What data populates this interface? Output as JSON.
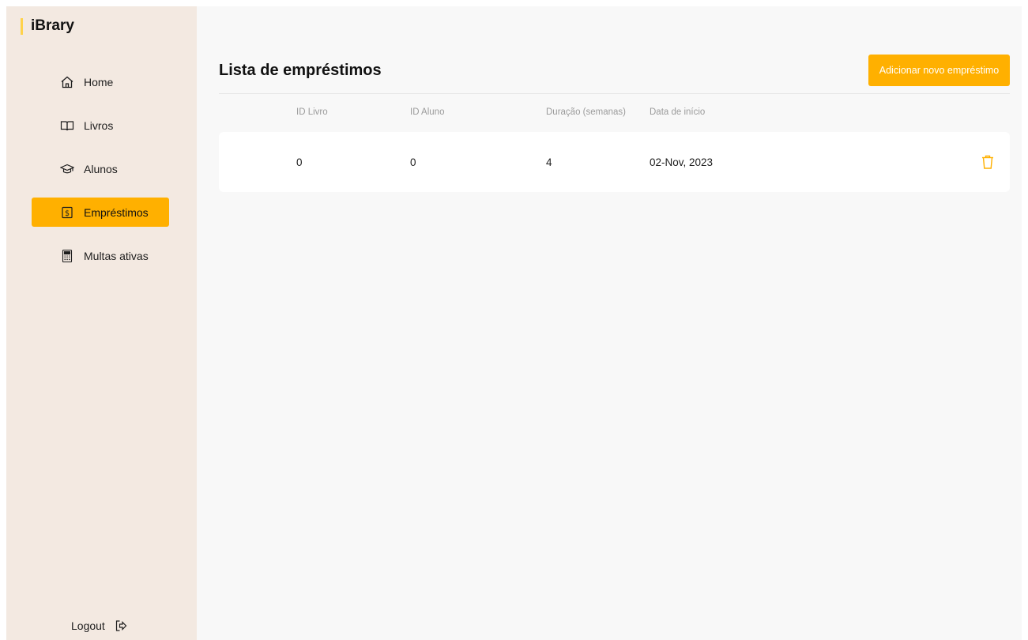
{
  "brand": {
    "name": "iBrary",
    "accent": "#ffd24a"
  },
  "theme": {
    "primary": "#ffb000",
    "sidebar_bg": "#f3e9e1",
    "main_bg": "#f8f8f8"
  },
  "sidebar": {
    "items": [
      {
        "label": "Home",
        "icon": "home-icon",
        "active": false
      },
      {
        "label": "Livros",
        "icon": "book-icon",
        "active": false
      },
      {
        "label": "Alunos",
        "icon": "graduation-cap-icon",
        "active": false
      },
      {
        "label": "Empréstimos",
        "icon": "dollar-square-icon",
        "active": true
      },
      {
        "label": "Multas ativas",
        "icon": "calculator-icon",
        "active": false
      }
    ],
    "logout": {
      "label": "Logout",
      "icon": "logout-icon"
    }
  },
  "main": {
    "title": "Lista de empréstimos",
    "add_button_label": "Adicionar novo empréstimo",
    "table": {
      "columns": [
        "ID Livro",
        "ID Aluno",
        "Duração (semanas)",
        "Data de início"
      ],
      "rows": [
        {
          "cells": [
            "0",
            "0",
            "4",
            "02-Nov, 2023"
          ],
          "action_icon": "trash-icon"
        }
      ]
    }
  }
}
